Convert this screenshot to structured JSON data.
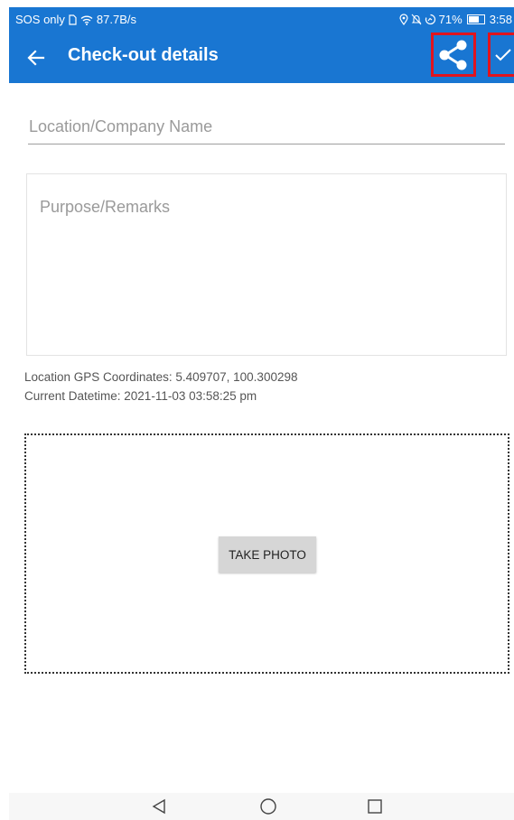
{
  "status_bar": {
    "carrier": "SOS only",
    "speed": "87.7B/s",
    "battery": "71%",
    "battery_level": 0.71,
    "time": "3:58",
    "icons_left": [
      "sim-icon",
      "wifi-icon"
    ],
    "icons_right": [
      "location-icon",
      "mute-icon",
      "data-saver-icon",
      "battery-icon"
    ]
  },
  "app_bar": {
    "title": "Check-out details",
    "background_color": "#1976d2",
    "icons": [
      "back-arrow-icon",
      "share-icon",
      "check-icon"
    ],
    "highlight_color": "#e0141e"
  },
  "form": {
    "location_placeholder": "Location/Company Name",
    "remarks_placeholder": "Purpose/Remarks",
    "gps_text": "Location GPS Coordinates: 5.409707, 100.300298",
    "datetime_text": "Current Datetime: 2021-11-03 03:58:25 pm"
  },
  "photo": {
    "take_photo_label": "TAKE PHOTO"
  },
  "nav_bar": {
    "icons": [
      "nav-back-icon",
      "nav-home-icon",
      "nav-recent-icon"
    ]
  }
}
